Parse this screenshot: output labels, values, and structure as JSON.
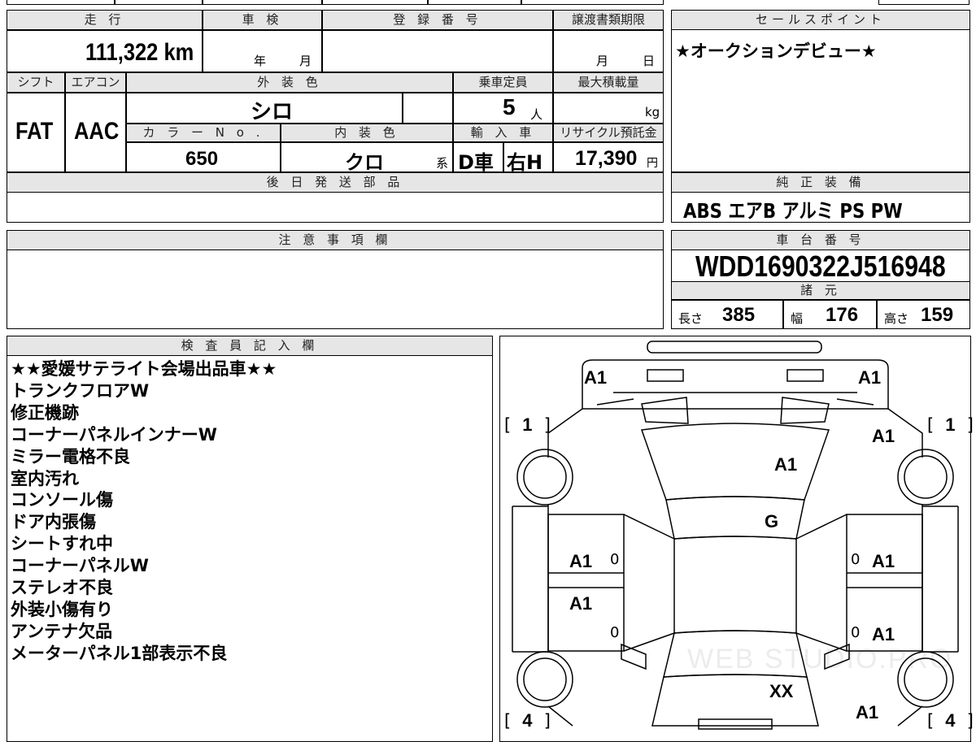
{
  "top_row": {
    "mileage_header": "走 行",
    "mileage_value": "111,322 km",
    "inspection_header": "車 検",
    "inspection_year_unit": "年",
    "inspection_month_unit": "月",
    "registration_header": "登 録 番 号",
    "transfer_deadline_header": "譲渡書類期限",
    "transfer_month_unit": "月",
    "transfer_day_unit": "日"
  },
  "sales_point": {
    "header": "セールスポイント",
    "text": "★オークションデビュー★"
  },
  "specs": {
    "shift_header": "シフト",
    "shift_value": "FAT",
    "ac_header": "エアコン",
    "ac_value": "AAC",
    "exterior_color_header": "外 装 色",
    "exterior_color_value": "シロ",
    "capacity_header": "乗車定員",
    "capacity_value": "5",
    "capacity_unit": "人",
    "max_load_header": "最大積載量",
    "max_load_unit": "kg",
    "color_no_header": "カ ラ ー N o .",
    "color_no_value": "650",
    "interior_color_header": "内 装 色",
    "interior_color_value": "クロ",
    "interior_color_suffix": "系",
    "import_header": "輸 入 車",
    "import_value": "D車",
    "steering_value": "右H",
    "recycle_header": "リサイクル預託金",
    "recycle_value": "17,390",
    "recycle_unit": "円"
  },
  "later_parts": {
    "header": "後 日 発 送 部 品",
    "text": ""
  },
  "genuine_equipment": {
    "header": "純 正 装 備",
    "text": "ABS エアB アルミ PS PW"
  },
  "caution": {
    "header": "注 意 事 項 欄",
    "text": ""
  },
  "chassis": {
    "header": "車 台 番 号",
    "value": "WDD1690322J516948"
  },
  "dimensions": {
    "header": "諸 元",
    "length_label": "長さ",
    "length_value": "385",
    "width_label": "幅",
    "width_value": "176",
    "height_label": "高さ",
    "height_value": "159"
  },
  "inspector": {
    "header": "検 査 員 記 入 欄",
    "notes": [
      "★★愛媛サテライト会場出品車★★",
      "トランクフロアW",
      "修正機跡",
      "コーナーパネルインナーW",
      "ミラー電格不良",
      "室内汚れ",
      "コンソール傷",
      "ドア内張傷",
      "シートすれ中",
      "コーナーパネルW",
      "ステレオ不良",
      "外装小傷有り",
      "アンテナ欠品",
      "メーターパネル1部表示不良"
    ]
  },
  "diagram": {
    "marks": {
      "rear_left_corner": "A1",
      "rear_right_corner": "A1",
      "rear_left_bracket": "1",
      "rear_right_bracket": "1",
      "right_rear_quarter": "A1",
      "trunk": "A1",
      "roof": "G",
      "left_rear_door": "A1",
      "left_rear_door_zero": "0",
      "left_front_door": "A1",
      "left_front_door_zero": "0",
      "right_rear_door": "A1",
      "right_rear_door_zero": "0",
      "right_front_door": "A1",
      "right_front_door_zero": "0",
      "hood": "XX",
      "front_right": "A1",
      "front_left_bracket": "4",
      "front_right_bracket": "4"
    },
    "watermark": "WEB STUDIO.PRO"
  }
}
